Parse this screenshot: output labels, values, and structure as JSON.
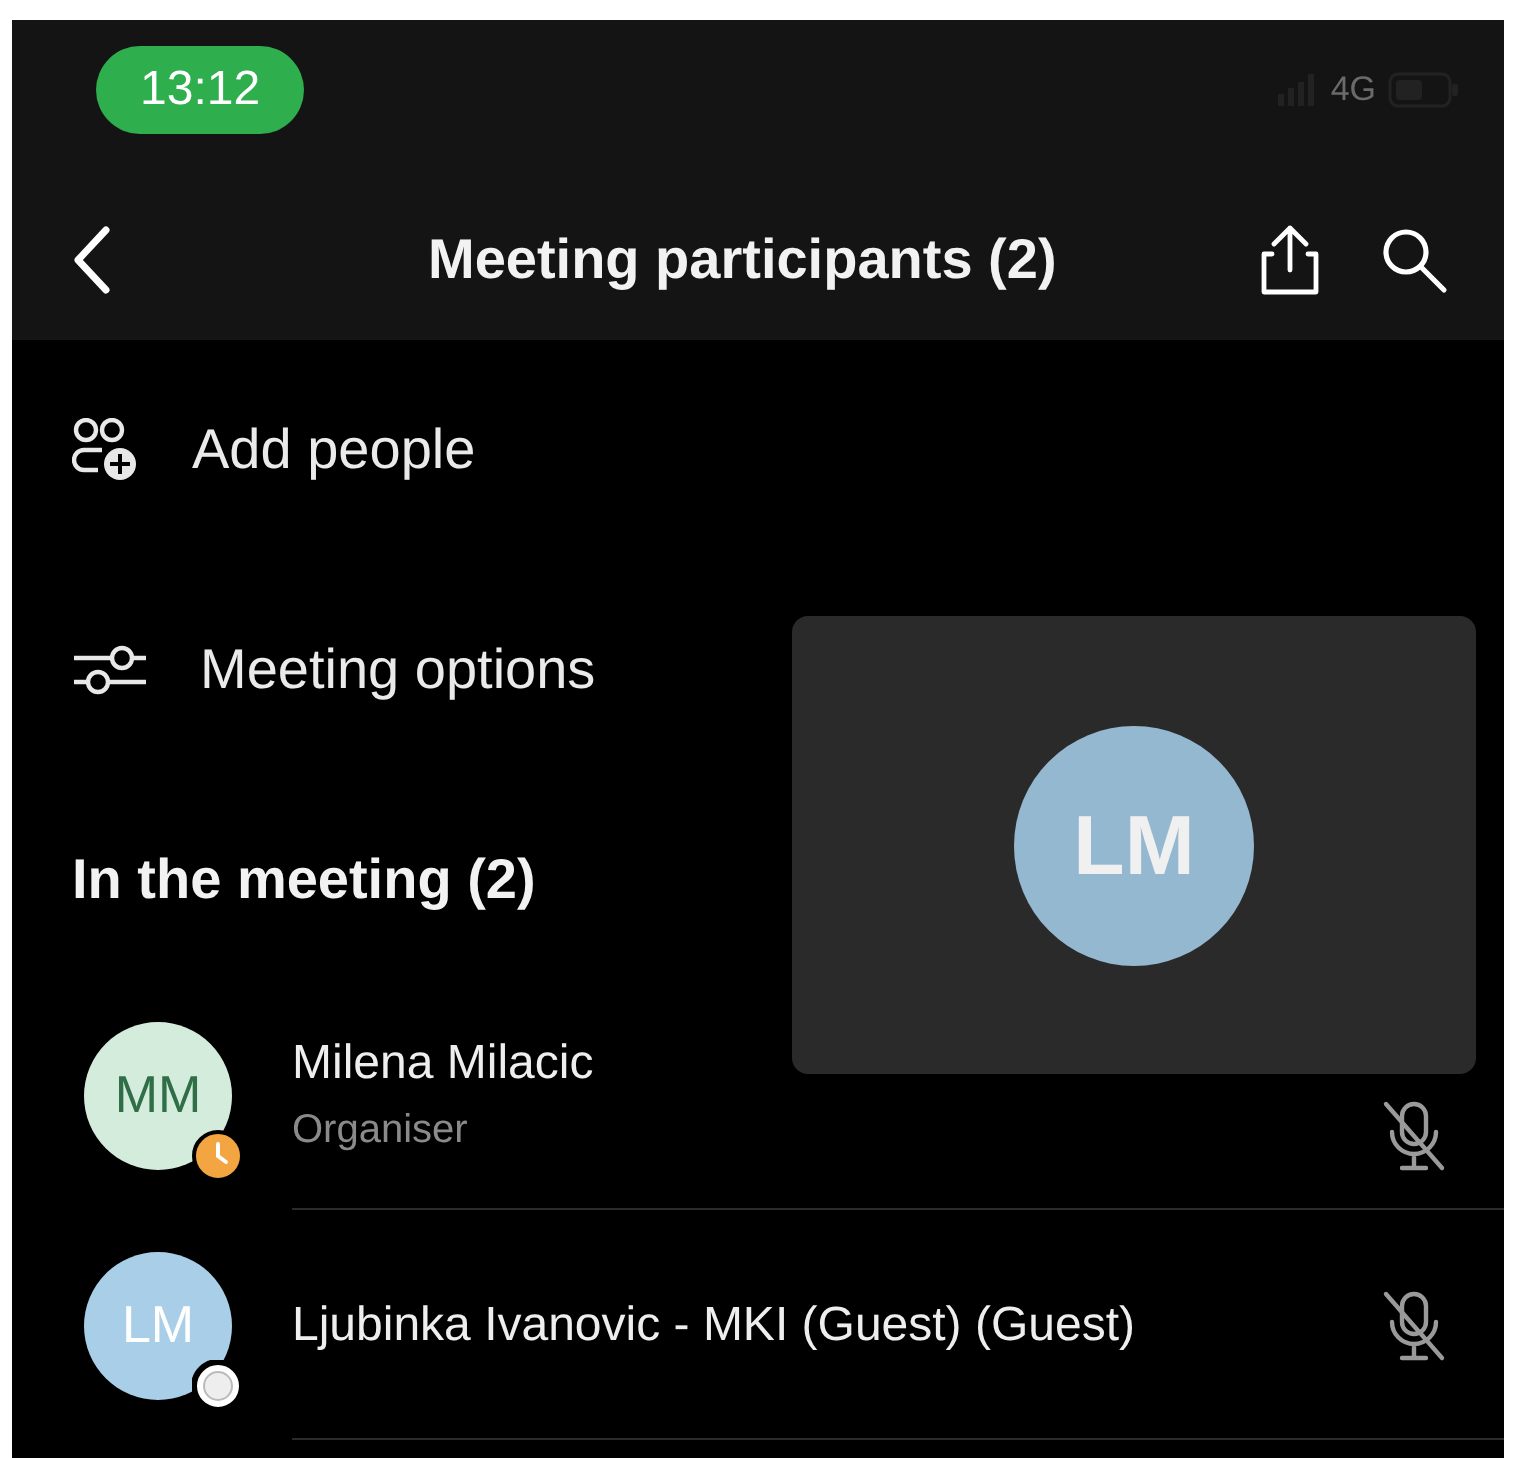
{
  "status_bar": {
    "time": "13:12",
    "network": "4G"
  },
  "nav": {
    "title": "Meeting participants (2)"
  },
  "actions": [
    {
      "kind": "add",
      "label": "Add people"
    },
    {
      "kind": "options",
      "label": "Meeting options"
    }
  ],
  "section": {
    "title": "In the meeting (2)"
  },
  "participants": [
    {
      "initials": "MM",
      "name": "Milena Milacic",
      "role": "Organiser",
      "color": "#d4ecdc",
      "kind": "away",
      "muted": true
    },
    {
      "initials": "LM",
      "name": "Ljubinka Ivanovic - MKI (Guest) (Guest)",
      "color": "#a9cfe8",
      "kind": "offline",
      "muted": true
    }
  ],
  "video_tile": {
    "initials": "LM",
    "color": "#95b8d1"
  }
}
